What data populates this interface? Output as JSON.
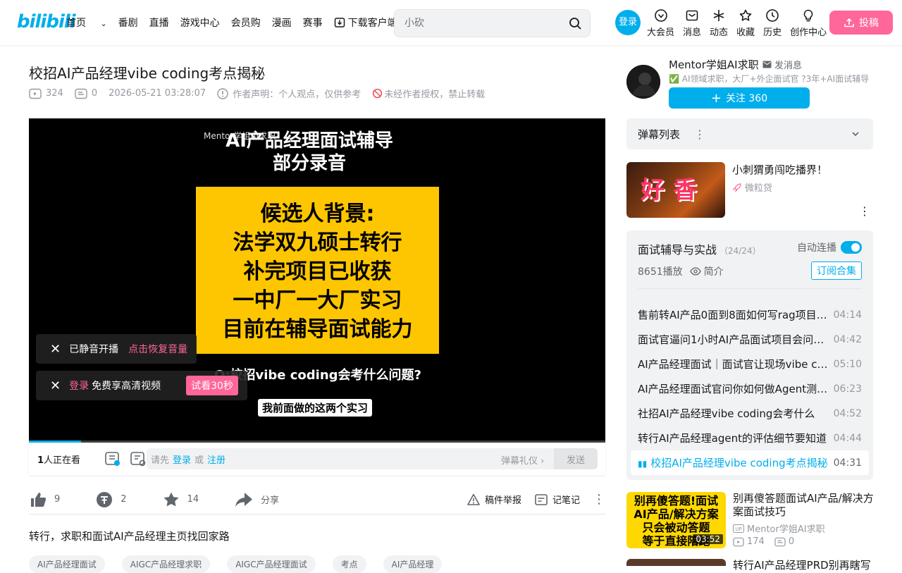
{
  "header": {
    "logo": "bilibili",
    "nav": [
      "首页",
      "番剧",
      "直播",
      "游戏中心",
      "会员购",
      "漫画",
      "赛事",
      "下载客户端"
    ],
    "new_badge": "新",
    "search_placeholder": "小砍",
    "login": "登录",
    "user_icons": [
      "大会员",
      "消息",
      "动态",
      "收藏",
      "历史",
      "创作中心"
    ],
    "upload": "投稿"
  },
  "video": {
    "title": "校招AI产品经理vibe coding考点揭秘",
    "views": "324",
    "danmaku_count": "0",
    "date": "2026-05-21 03:28:07",
    "statement": "作者声明：个人观点，仅供参考",
    "copyright": "未经作者授权，禁止转载"
  },
  "player": {
    "brand": "Mentor学姐AI求职",
    "heading": "AI产品经理面试辅导\n部分录音",
    "card": "候选人背景:\n法学双九硕士转行\n补完项目已收获\n一中厂一大厂实习\n目前在辅导面试能力",
    "question": "Q:校招vibe coding会考什么问题?",
    "subtitle": "我前面做的这两个实习",
    "toast1_text": "已静音开播",
    "toast1_action": "点击恢复音量",
    "toast2_login": "登录",
    "toast2_text": "免费享高清视频",
    "toast2_action": "试看30秒",
    "progress_pct": 9
  },
  "danmaku_bar": {
    "watching_count": "1",
    "watching_label": "人正在看",
    "prefix": "请先",
    "login": "登录",
    "or": "或",
    "register": "注册",
    "gift": "弹幕礼仪",
    "send": "发送"
  },
  "actions": {
    "like": "9",
    "coin": "2",
    "fav": "14",
    "share": "分享",
    "report": "稿件举报",
    "note": "记笔记"
  },
  "description": "转行，求职和面试AI产品经理主页找回家路",
  "tags": [
    "AI产品经理面试",
    "AIGC产品经理求职",
    "AIGC产品经理面试",
    "考点",
    "AI产品经理"
  ],
  "uploader": {
    "name": "Mentor学姐AI求职",
    "message": "发消息",
    "desc": "✅ AI领域求职，大厂+外企面试官 ?3年+AI面试辅导",
    "follow": "关注 360"
  },
  "danmaku_list": {
    "label": "弹幕列表"
  },
  "ad": {
    "thumb_text": "好 香",
    "title": "小刺猬勇闯吃播界！",
    "source": "微粒贷"
  },
  "series": {
    "title": "面试辅导与实战",
    "count": "（24/24）",
    "autoplay": "自动连播",
    "plays": "8651播放",
    "intro": "简介",
    "subscribe": "订阅合集",
    "episodes": [
      {
        "title": "售前转AI产品0面到8面如何写rag项目P…",
        "dur": "04:14"
      },
      {
        "title": "面试官逼问1小时AI产品面试项目会问…",
        "dur": "04:42"
      },
      {
        "title": "AI产品经理面试｜面试官让现场vibe co…",
        "dur": "05:10"
      },
      {
        "title": "AI产品经理面试官问你如何做Agent测…",
        "dur": "06:23"
      },
      {
        "title": "社招AI产品经理vibe coding会考什么",
        "dur": "04:52"
      },
      {
        "title": "转行AI产品经理agent的评估细节要知道",
        "dur": "04:44"
      },
      {
        "title": "校招AI产品经理vibe coding考点揭秘",
        "dur": "04:31"
      }
    ]
  },
  "recommend": {
    "thumb_text": "别再傻答题!面试\nAI产品/解决方案\n只会被动答题\n等于直接陪跑",
    "duration": "03:52",
    "title": "别再傻答题面试AI产品/解决方案面试技巧",
    "up": "Mentor学姐AI求职",
    "views": "174",
    "danmaku": "0"
  },
  "recommend2": {
    "title": "转行AI产品经理PRD别再瞎写"
  }
}
